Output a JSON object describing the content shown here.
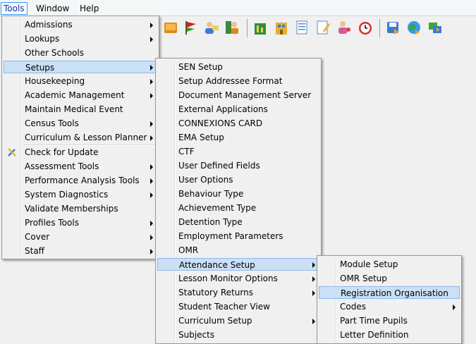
{
  "menubar": {
    "items": [
      {
        "label": "Tools",
        "active": true
      },
      {
        "label": "Window",
        "active": false
      },
      {
        "label": "Help",
        "active": false
      }
    ]
  },
  "toolbar": {
    "icons": [
      "book-icon",
      "flag-icon",
      "users-icon",
      "teacher-icon",
      "building-chart-icon",
      "building-icon",
      "documents-icon",
      "edit-document-icon",
      "people-icon",
      "clock-icon",
      "save-icon",
      "globe-icon",
      "transfer-icon"
    ]
  },
  "tools_menu": {
    "items": [
      {
        "label": "Admissions",
        "submenu": true
      },
      {
        "label": "Lookups",
        "submenu": true
      },
      {
        "label": "Other Schools",
        "submenu": false
      },
      {
        "label": "Setups",
        "submenu": true,
        "highlighted": true
      },
      {
        "label": "Housekeeping",
        "submenu": true
      },
      {
        "label": "Academic Management",
        "submenu": true
      },
      {
        "label": "Maintain Medical Event",
        "submenu": false
      },
      {
        "label": "Census Tools",
        "submenu": true
      },
      {
        "label": "Curriculum & Lesson Planner",
        "submenu": true
      },
      {
        "label": "Check for Update",
        "submenu": false,
        "icon": "tools-icon"
      },
      {
        "label": "Assessment Tools",
        "submenu": true
      },
      {
        "label": "Performance Analysis Tools",
        "submenu": true
      },
      {
        "label": "System Diagnostics",
        "submenu": true
      },
      {
        "label": "Validate Memberships",
        "submenu": false
      },
      {
        "label": "Profiles Tools",
        "submenu": true
      },
      {
        "label": "Cover",
        "submenu": true
      },
      {
        "label": "Staff",
        "submenu": true
      }
    ]
  },
  "setups_menu": {
    "items": [
      {
        "label": "SEN Setup",
        "submenu": false
      },
      {
        "label": "Setup Addressee Format",
        "submenu": false
      },
      {
        "label": "Document Management Server",
        "submenu": false
      },
      {
        "label": "External Applications",
        "submenu": false
      },
      {
        "label": "CONNEXIONS CARD",
        "submenu": false
      },
      {
        "label": "EMA Setup",
        "submenu": false
      },
      {
        "label": "CTF",
        "submenu": false
      },
      {
        "label": "User Defined Fields",
        "submenu": false
      },
      {
        "label": "User Options",
        "submenu": false
      },
      {
        "label": "Behaviour Type",
        "submenu": false
      },
      {
        "label": "Achievement Type",
        "submenu": false
      },
      {
        "label": "Detention Type",
        "submenu": false
      },
      {
        "label": "Employment Parameters",
        "submenu": false
      },
      {
        "label": "OMR",
        "submenu": false
      },
      {
        "label": "Attendance Setup",
        "submenu": true,
        "highlighted": true
      },
      {
        "label": "Lesson Monitor Options",
        "submenu": true
      },
      {
        "label": "Statutory Returns",
        "submenu": true
      },
      {
        "label": "Student Teacher View",
        "submenu": false
      },
      {
        "label": "Curriculum Setup",
        "submenu": true
      },
      {
        "label": "Subjects",
        "submenu": false
      }
    ]
  },
  "attendance_menu": {
    "items": [
      {
        "label": "Module Setup",
        "submenu": false
      },
      {
        "label": "OMR Setup",
        "submenu": false
      },
      {
        "label": "Registration Organisation",
        "submenu": false,
        "highlighted": true
      },
      {
        "label": "Codes",
        "submenu": true
      },
      {
        "label": "Part Time Pupils",
        "submenu": false
      },
      {
        "label": "Letter Definition",
        "submenu": false
      }
    ]
  }
}
